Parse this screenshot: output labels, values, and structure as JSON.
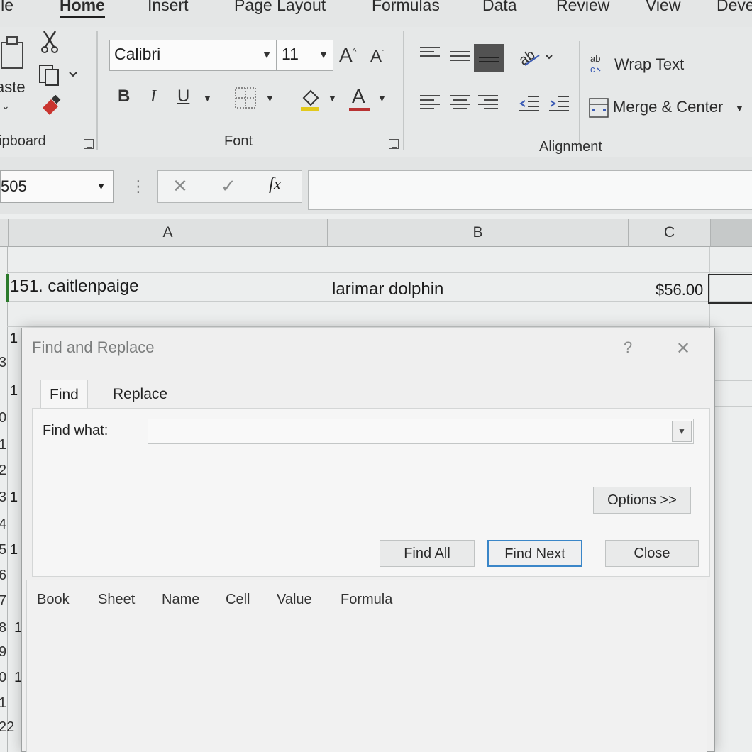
{
  "ribbon": {
    "tabs": [
      {
        "label": "ile",
        "active": false
      },
      {
        "label": "Home",
        "active": true
      },
      {
        "label": "Insert",
        "active": false
      },
      {
        "label": "Page Layout",
        "active": false
      },
      {
        "label": "Formulas",
        "active": false
      },
      {
        "label": "Data",
        "active": false
      },
      {
        "label": "Review",
        "active": false
      },
      {
        "label": "View",
        "active": false
      },
      {
        "label": "Deve",
        "active": false
      }
    ],
    "clipboard": {
      "paste_label": "aste",
      "group_label": "ipboard"
    },
    "font": {
      "name": "Calibri",
      "size": "11",
      "group_label": "Font",
      "bold": "B",
      "italic": "I",
      "underline": "U",
      "grow": "A",
      "shrink": "A",
      "font_color": "A"
    },
    "alignment": {
      "wrap_text": "Wrap Text",
      "merge_center": "Merge & Center",
      "group_label": "Alignment"
    }
  },
  "formula_bar": {
    "name_box": "505",
    "formula": ""
  },
  "grid": {
    "columns": [
      "A",
      "B",
      "C"
    ],
    "row_numbers": [
      "1",
      "3",
      "1",
      "0",
      "1",
      "2",
      "3",
      "4",
      "5",
      "6",
      "7",
      "8",
      "9",
      "0",
      "1",
      "22"
    ],
    "row_values_partial": [
      "1",
      "1",
      "1",
      "1",
      "1",
      "1"
    ],
    "row": {
      "a": "151. caitlenpaige",
      "b": "larimar dolphin",
      "c": "$56.00"
    }
  },
  "dialog": {
    "title": "Find and Replace",
    "help": "?",
    "close_x": "✕",
    "tabs": [
      "Find",
      "Replace"
    ],
    "find_what_label": "Find what:",
    "find_what_value": "",
    "options_button": "Options >>",
    "find_all_button": "Find All",
    "find_next_button": "Find Next",
    "close_button": "Close",
    "result_columns": [
      "Book",
      "Sheet",
      "Name",
      "Cell",
      "Value",
      "Formula"
    ]
  },
  "colors": {
    "accent": "#3a86c8",
    "font_color_bar": "#b83232",
    "highlight_bar": "#e2c91c"
  }
}
